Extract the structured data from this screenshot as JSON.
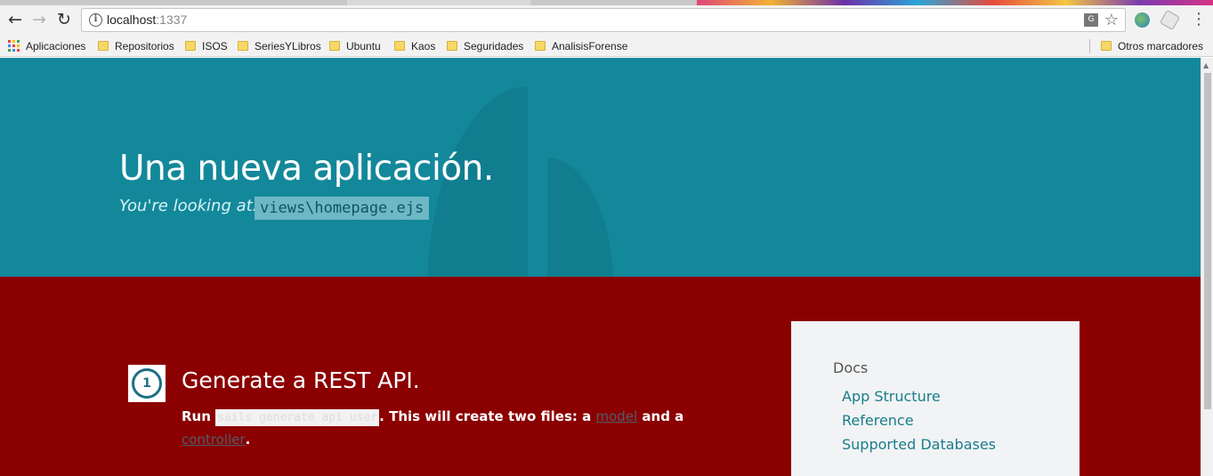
{
  "browser": {
    "url_host": "localhost",
    "url_port": ":1337",
    "back_icon": "arrow-left-icon",
    "forward_icon": "arrow-right-icon",
    "reload_icon": "reload-icon"
  },
  "bookmarks": {
    "apps_label": "Aplicaciones",
    "items": [
      {
        "label": "Repositorios"
      },
      {
        "label": "ISOS"
      },
      {
        "label": "SeriesYLibros"
      },
      {
        "label": "Ubuntu"
      },
      {
        "label": "Kaos"
      },
      {
        "label": "Seguridades"
      },
      {
        "label": "AnalisisForense"
      }
    ],
    "other_label": "Otros marcadores"
  },
  "hero": {
    "title": "Una nueva aplicación.",
    "subtitle": "You're looking at:",
    "file": "views\\homepage.ejs"
  },
  "step": {
    "number": "1",
    "title": "Generate a REST API.",
    "run_label": "Run",
    "command": "sails generate api user",
    "text_after_command": ". This will create two files: a",
    "model_link": "model",
    "text_and": "and a",
    "controller_link": "controller",
    "period": "."
  },
  "docs": {
    "heading": "Docs",
    "links": [
      {
        "label": "App Structure"
      },
      {
        "label": "Reference"
      },
      {
        "label": "Supported Databases"
      }
    ]
  },
  "colors": {
    "hero_bg": "#13889a",
    "content_bg": "#8b0000",
    "docs_bg": "#f1f3f4",
    "link": "#1a7c8c"
  }
}
